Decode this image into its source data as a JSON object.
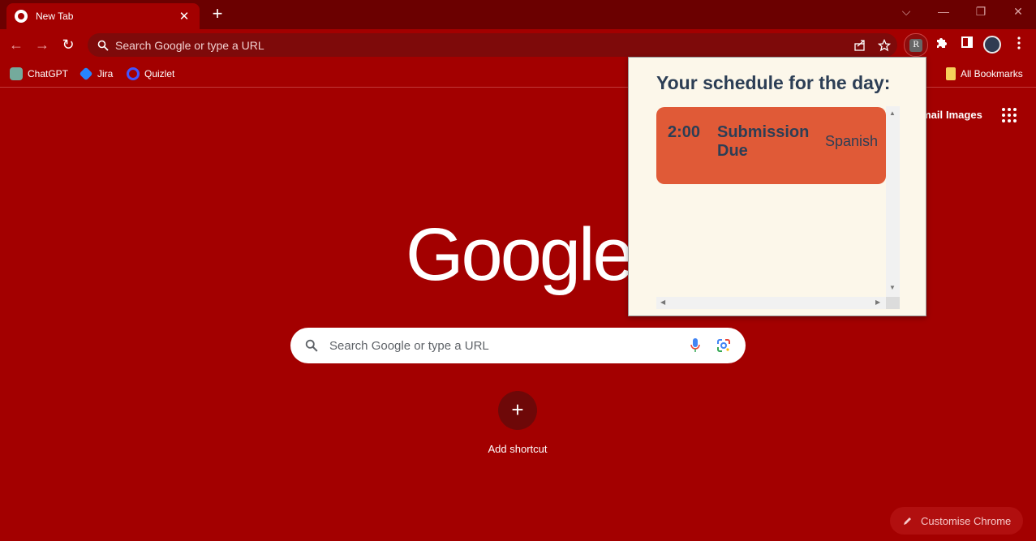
{
  "tab": {
    "title": "New Tab",
    "close": "✕",
    "new_tab": "+"
  },
  "window": {
    "dropdown": "⌵",
    "minimize": "—",
    "restore": "❐",
    "close": "✕"
  },
  "toolbar": {
    "back": "←",
    "forward": "→",
    "reload": "↻",
    "omnibox_placeholder": "Search Google or type a URL",
    "extension_letter": "R"
  },
  "bookmarks": [
    {
      "label": "ChatGPT",
      "color": "#74aa9c"
    },
    {
      "label": "Jira",
      "color": "#2684ff"
    },
    {
      "label": "Quizlet",
      "color": "#4255ff"
    }
  ],
  "bookmarks_right": {
    "label": "All Bookmarks"
  },
  "page": {
    "logo": "Google",
    "search_placeholder": "Search Google or type a URL",
    "top_links": {
      "gmail": "Gmail",
      "images": "Images"
    },
    "add_shortcut": "Add shortcut",
    "customise": "Customise Chrome"
  },
  "popup": {
    "title": "Your schedule for the day:",
    "items": [
      {
        "time": "2:00",
        "title": "Submission Due",
        "subject": "Spanish",
        "color": "#e05a37"
      }
    ]
  }
}
